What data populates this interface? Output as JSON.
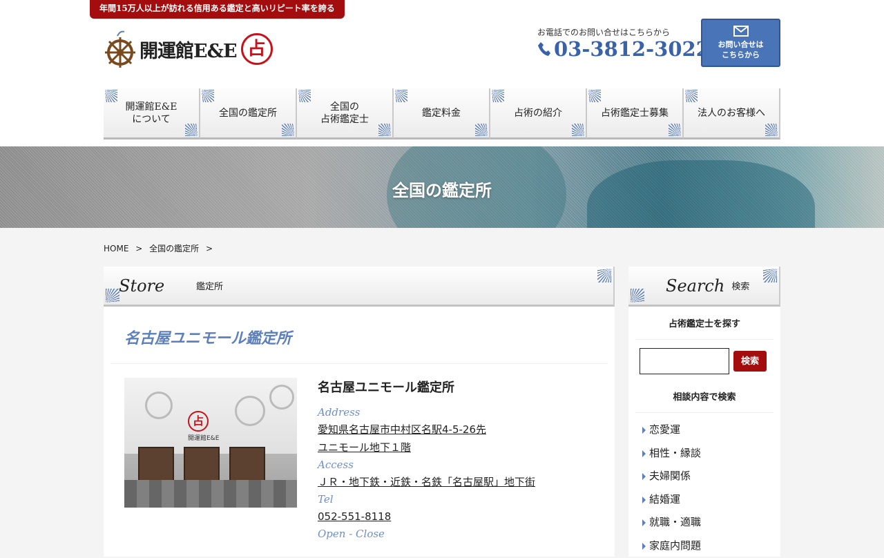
{
  "header": {
    "tagline": "年間15万人以上が訪れる信用ある鑑定と高いリピート率を誇る",
    "logo_text": "開運館E&E",
    "logo_seal": "占",
    "phone_caption": "お電話でのお問い合せはこちらから",
    "phone_number": "03-3812-3022",
    "contact_label_1": "お問い合せは",
    "contact_label_2": "こちらから"
  },
  "nav": {
    "items": [
      {
        "label": "開運館E&E\nについて"
      },
      {
        "label": "全国の鑑定所"
      },
      {
        "label": "全国の\n占術鑑定士"
      },
      {
        "label": "鑑定料金"
      },
      {
        "label": "占術の紹介"
      },
      {
        "label": "占術鑑定士募集"
      },
      {
        "label": "法人のお客様へ"
      }
    ]
  },
  "hero": {
    "title": "全国の鑑定所"
  },
  "breadcrumb": {
    "home": "HOME",
    "sep": ">",
    "current": "全国の鑑定所"
  },
  "main": {
    "section_en": "Store",
    "section_jp": "鑑定所",
    "store_title": "名古屋ユニモール鑑定所",
    "photo_sign": "占",
    "photo_sign_text": "開運館E&E",
    "store": {
      "name": "名古屋ユニモール鑑定所",
      "address_label": "Address",
      "address_line1": "愛知県名古屋市中村区名駅4-5-26先",
      "address_line2": "ユニモール地下１階",
      "access_label": "Access",
      "access": "ＪＲ・地下鉄・近鉄・名鉄「名古屋駅」地下街",
      "tel_label": "Tel",
      "tel": "052-551-8118",
      "open_label": "Open - Close"
    }
  },
  "sidebar": {
    "section_en": "Search",
    "section_jp": "検索",
    "find_title": "占術鑑定士を探す",
    "search_button": "検索",
    "search_input_value": "",
    "category_title": "相談内容で検索",
    "categories": [
      "恋愛運",
      "相性・縁談",
      "夫婦関係",
      "結婚運",
      "就職・適職",
      "家庭内問題"
    ]
  }
}
